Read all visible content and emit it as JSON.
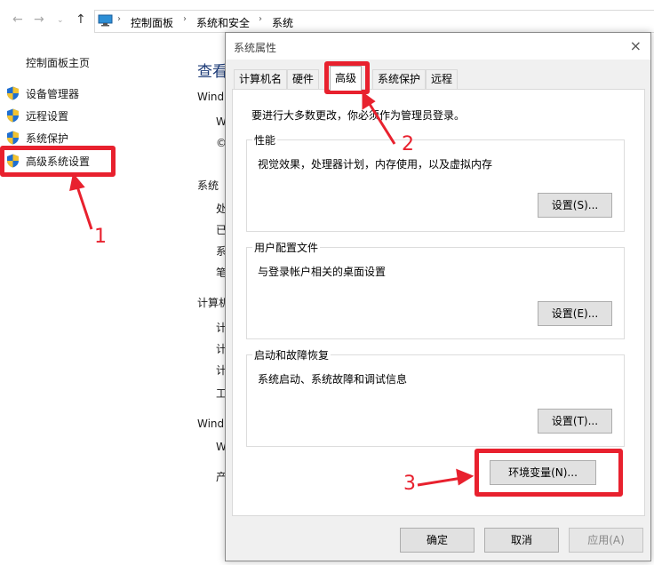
{
  "address_bar": {
    "crumbs": [
      "控制面板",
      "系统和安全",
      "系统"
    ],
    "icons": [
      "back-arrow-icon",
      "forward-arrow-icon",
      "dropdown-icon",
      "up-arrow-icon",
      "computer-icon",
      "separator-icon"
    ]
  },
  "left_nav": {
    "home": "控制面板主页",
    "items": [
      {
        "label": "设备管理器",
        "icon": "shield-icon"
      },
      {
        "label": "远程设置",
        "icon": "shield-icon"
      },
      {
        "label": "系统保护",
        "icon": "shield-icon"
      },
      {
        "label": "高级系统设置",
        "icon": "shield-icon"
      }
    ]
  },
  "background": {
    "title": "查看",
    "windows_label": "Wind",
    "w1": "W",
    "c1": "©",
    "system_label": "系统",
    "s1": "处",
    "s2": "已",
    "s3": "系",
    "s4": "笔",
    "computer_label": "计算机",
    "c2": "计",
    "c3": "计",
    "c4": "计",
    "c5": "工",
    "windows2_label": "Wind",
    "w2": "W",
    "p1": "产"
  },
  "dialog": {
    "title": "系统属性",
    "close": "×",
    "tabs": [
      "计算机名",
      "硬件",
      "高级",
      "系统保护",
      "远程"
    ],
    "active_tab": "高级",
    "notice": "要进行大多数更改，你必须作为管理员登录。",
    "groups": [
      {
        "legend": "性能",
        "desc": "视觉效果，处理器计划，内存使用，以及虚拟内存",
        "button": "设置(S)..."
      },
      {
        "legend": "用户配置文件",
        "desc": "与登录帐户相关的桌面设置",
        "button": "设置(E)..."
      },
      {
        "legend": "启动和故障恢复",
        "desc": "系统启动、系统故障和调试信息",
        "button": "设置(T)..."
      }
    ],
    "env_button": "环境变量(N)...",
    "ok": "确定",
    "cancel": "取消",
    "apply": "应用(A)"
  },
  "annotations": {
    "n1": "1",
    "n2": "2",
    "n3": "3",
    "color": "#e8212e"
  }
}
